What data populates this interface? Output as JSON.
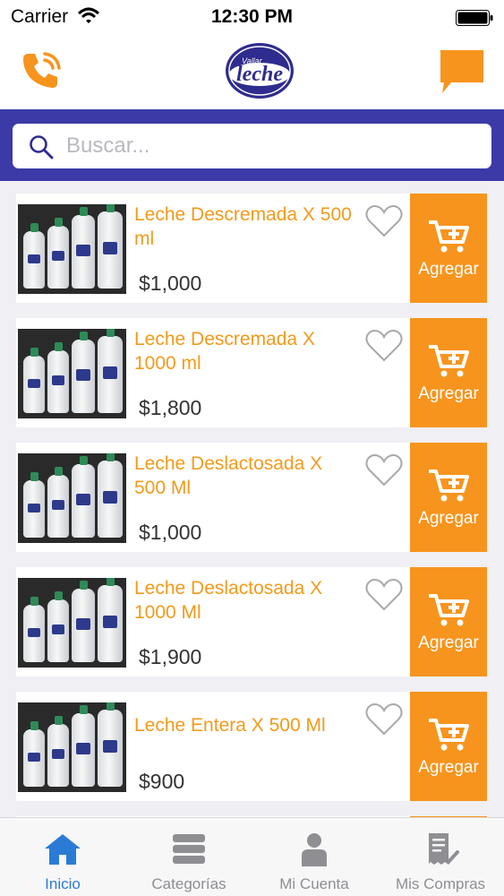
{
  "status_bar": {
    "carrier": "Carrier",
    "time": "12:30 PM"
  },
  "header": {
    "logo_text": "leche",
    "logo_small_text": "Vallar",
    "phone_icon": "phone-icon",
    "chat_icon": "chat-icon",
    "accent_color": "#f7941d"
  },
  "search": {
    "placeholder": "Buscar...",
    "value": "",
    "band_color": "#3b3aa6"
  },
  "products": [
    {
      "name": "Leche Descremada  X 500 ml",
      "price": "$1,000",
      "add_label": "Agregar"
    },
    {
      "name": "Leche Descremada X 1000 ml",
      "price": "$1,800",
      "add_label": "Agregar"
    },
    {
      "name": "Leche Deslactosada X 500 Ml",
      "price": "$1,000",
      "add_label": "Agregar"
    },
    {
      "name": "Leche Deslactosada X 1000 Ml",
      "price": "$1,900",
      "add_label": "Agregar"
    },
    {
      "name": "Leche Entera X 500 Ml",
      "price": "$900",
      "add_label": "Agregar"
    }
  ],
  "tabs": [
    {
      "label": "Inicio",
      "icon": "home-icon",
      "active": true
    },
    {
      "label": "Categorías",
      "icon": "list-icon",
      "active": false
    },
    {
      "label": "Mi Cuenta",
      "icon": "user-icon",
      "active": false
    },
    {
      "label": "Mis Compras",
      "icon": "receipt-icon",
      "active": false
    }
  ],
  "colors": {
    "product_name": "#f39a1b",
    "add_button": "#f7941d",
    "active_tab": "#2b7bd6"
  }
}
